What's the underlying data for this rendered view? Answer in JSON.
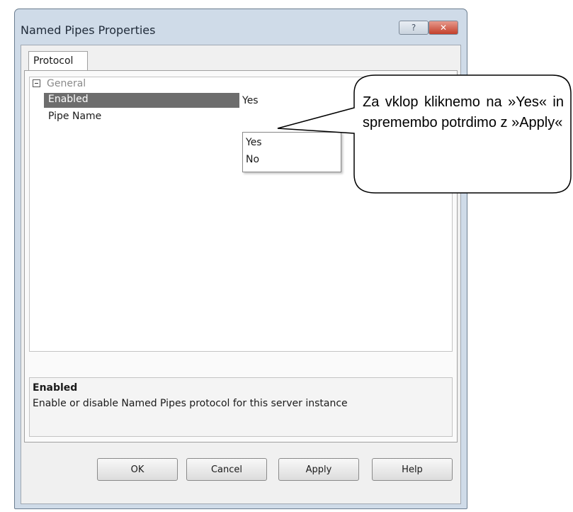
{
  "window": {
    "title": "Named Pipes Properties",
    "help_glyph": "?",
    "close_glyph": "✕"
  },
  "tabs": [
    {
      "label": "Protocol"
    }
  ],
  "property_grid": {
    "category": "General",
    "properties": [
      {
        "name": "Enabled",
        "value": "Yes",
        "selected": true
      },
      {
        "name": "Pipe Name",
        "value": "",
        "selected": false
      }
    ],
    "dropdown_options": [
      "Yes",
      "No"
    ]
  },
  "description": {
    "title": "Enabled",
    "text": "Enable or disable Named Pipes protocol for this server instance"
  },
  "buttons": {
    "ok": "OK",
    "cancel": "Cancel",
    "apply": "Apply",
    "help": "Help"
  },
  "callout": {
    "text": "Za vklop kliknemo na »Yes« in spremembo potrdimo z »Apply«"
  },
  "colors": {
    "selected_row": "#6d6d6d",
    "window_frame": "#cfdbe8",
    "close_button": "#c3402b"
  }
}
